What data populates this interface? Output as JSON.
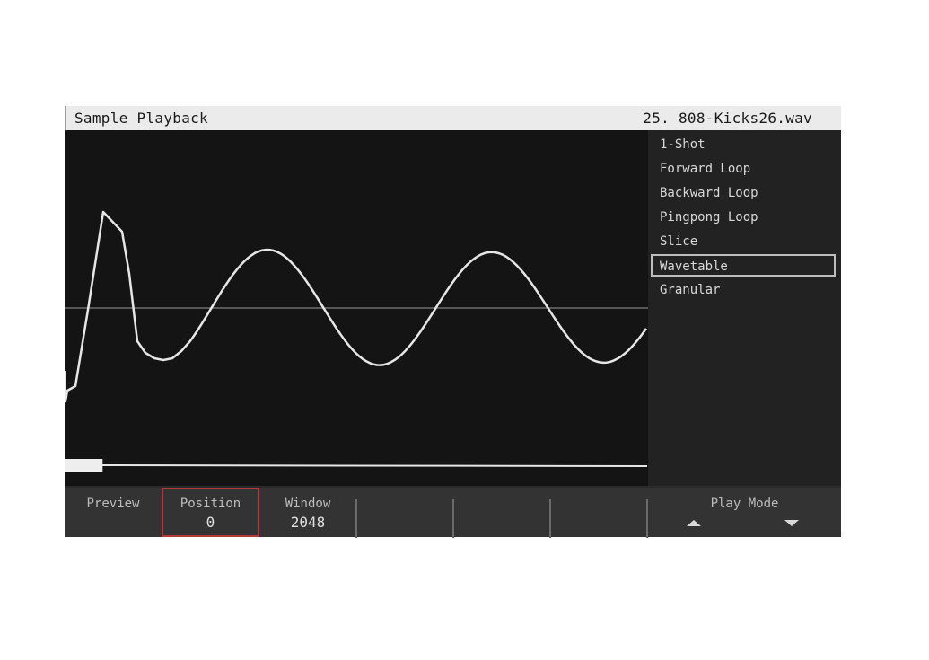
{
  "header": {
    "title": "Sample Playback",
    "file_label": "25. 808-Kicks26.wav"
  },
  "play_modes": {
    "items": [
      "1-Shot",
      "Forward Loop",
      "Backward Loop",
      "Pingpong Loop",
      "Slice",
      "Wavetable",
      "Granular"
    ],
    "selected_index": 5
  },
  "waveform": {
    "playhead_position_fraction": 0.0,
    "window_fraction": 0.065
  },
  "footer": {
    "preview_label": "Preview",
    "position_label": "Position",
    "position_value": "0",
    "window_label": "Window",
    "window_value": "2048",
    "play_mode_label": "Play Mode",
    "arrow_up_icon": "triangle-up",
    "arrow_down_icon": "triangle-down"
  },
  "colors": {
    "selection_border": "#b43a3a",
    "waveform_line": "#e6e6e6",
    "background": "#141414"
  }
}
